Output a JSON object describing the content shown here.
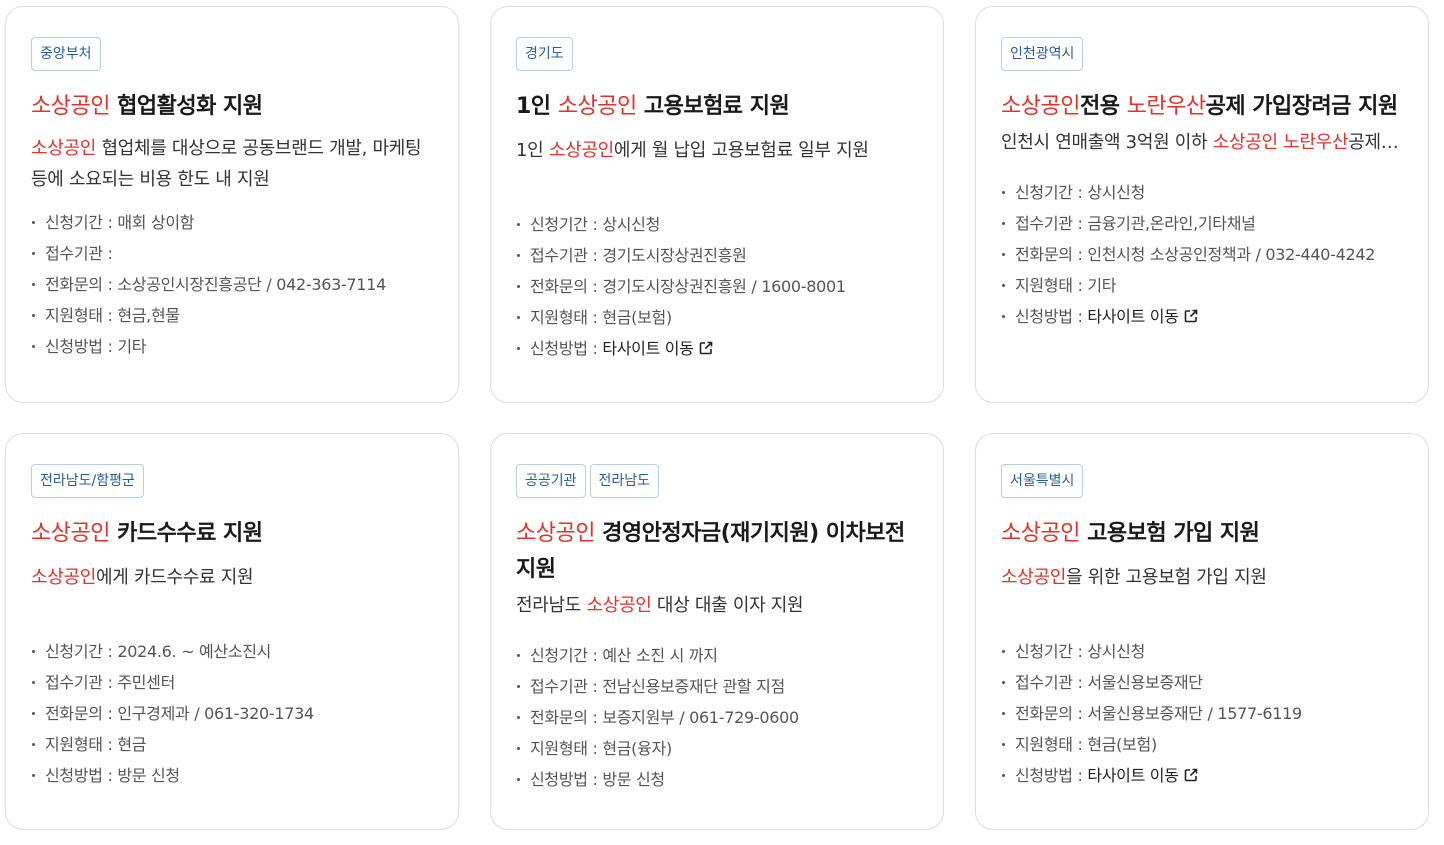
{
  "cards": [
    {
      "tags": [
        "중앙부처"
      ],
      "title_hl": "소상공인",
      "title_rest": " 협업활성화 지원",
      "desc_hl": "소상공인",
      "desc_rest": " 협업체를 대상으로 공동브랜드 개발, 마케팅 등에 소요되는 비용 한도 내 지원",
      "info": {
        "period": "신청기간 : 매회 상이함",
        "agency": "접수기관 : ",
        "phone": "전화문의 : 소상공인시장진흥공단 / 042-363-7114",
        "type": "지원형태 : 현금,현물",
        "method_label": "신청방법 : ",
        "method_value": "기타"
      }
    },
    {
      "tags": [
        "경기도"
      ],
      "title_pre": "1인 ",
      "title_hl": "소상공인",
      "title_rest": " 고용보험료 지원",
      "desc_pre": "1인 ",
      "desc_hl": "소상공인",
      "desc_rest": "에게 월 납입 고용보험료 일부 지원",
      "info": {
        "period": "신청기간 : 상시신청",
        "agency": "접수기관 : 경기도시장상권진흥원",
        "phone": "전화문의 : 경기도시장상권진흥원 / 1600-8001",
        "type": "지원형태 : 현금(보험)",
        "method_label": "신청방법 : ",
        "method_value": "타사이트 이동"
      }
    },
    {
      "tags": [
        "인천광역시"
      ],
      "title_hl": "소상공인",
      "title_mid": "전용 ",
      "title_hl2": "노란우산",
      "title_rest": "공제 가입장려금 지원",
      "desc_pre": "인천시 연매출액 3억원 이하 ",
      "desc_hl": "소상공인 노란우산",
      "desc_rest": "공제 가입장려금 지원",
      "info": {
        "period": "신청기간 : 상시신청",
        "agency": "접수기관 : 금융기관,온라인,기타채널",
        "phone": "전화문의 : 인천시청 소상공인정책과 / 032-440-4242",
        "type": "지원형태 : 기타",
        "method_label": "신청방법 : ",
        "method_value": "타사이트 이동"
      }
    },
    {
      "tags": [
        "전라남도/함평군"
      ],
      "title_hl": "소상공인",
      "title_rest": " 카드수수료 지원",
      "desc_hl": "소상공인",
      "desc_rest": "에게 카드수수료 지원",
      "info": {
        "period": "신청기간 : 2024.6. ~ 예산소진시",
        "agency": "접수기관 : 주민센터",
        "phone": "전화문의 : 인구경제과 / 061-320-1734",
        "type": "지원형태 : 현금",
        "method_label": "신청방법 : ",
        "method_value": "방문 신청"
      }
    },
    {
      "tags": [
        "공공기관",
        "전라남도"
      ],
      "title_hl": "소상공인",
      "title_rest": " 경영안정자금(재기지원) 이차보전 지원",
      "desc_pre": "전라남도 ",
      "desc_hl": "소상공인",
      "desc_rest": " 대상 대출 이자 지원",
      "info": {
        "period": "신청기간 : 예산 소진 시 까지",
        "agency": "접수기관 : 전남신용보증재단 관할 지점",
        "phone": "전화문의 : 보증지원부 / 061-729-0600",
        "type": "지원형태 : 현금(융자)",
        "method_label": "신청방법 : ",
        "method_value": "방문 신청"
      }
    },
    {
      "tags": [
        "서울특별시"
      ],
      "title_hl": "소상공인",
      "title_rest": " 고용보험 가입 지원",
      "desc_hl": "소상공인",
      "desc_rest": "을 위한 고용보험 가입 지원",
      "info": {
        "period": "신청기간 : 상시신청",
        "agency": "접수기관 : 서울신용보증재단",
        "phone": "전화문의 : 서울신용보증재단 / 1577-6119",
        "type": "지원형태 : 현금(보험)",
        "method_label": "신청방법 : ",
        "method_value": "타사이트 이동"
      }
    }
  ],
  "colors": {
    "highlight": "#e8302a",
    "tag_text": "#2a5d9a",
    "tag_border": "#b9cde3",
    "card_border": "#dddddd"
  },
  "icons": {
    "external_link": "external-link-icon"
  }
}
